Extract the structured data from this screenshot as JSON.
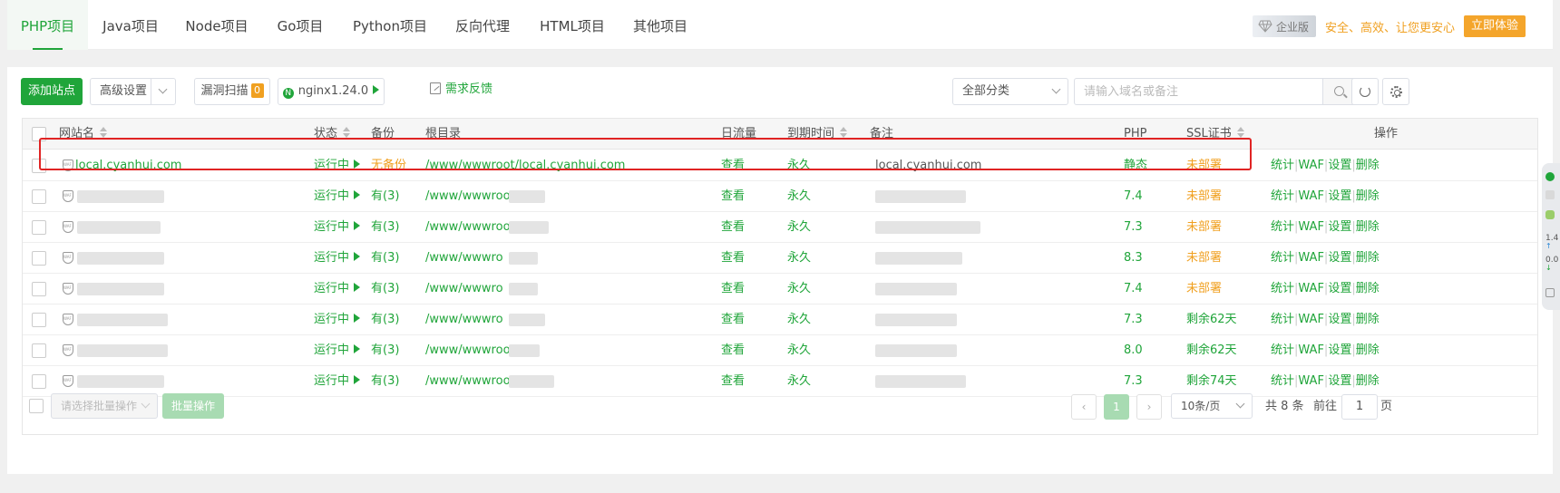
{
  "tabs": [
    "PHP项目",
    "Java项目",
    "Node项目",
    "Go项目",
    "Python项目",
    "反向代理",
    "HTML项目",
    "其他项目"
  ],
  "enterprise": {
    "badge": "企业版",
    "slogan": "安全、高效、让您更安心",
    "cta": "立即体验"
  },
  "toolbar": {
    "add_site": "添加站点",
    "advanced": "高级设置",
    "scan": "漏洞扫描",
    "scan_count": "0",
    "nginx": "nginx1.24.0",
    "feedback": "需求反馈",
    "category": "全部分类",
    "search_placeholder": "请输入域名或备注"
  },
  "table": {
    "headers": {
      "site": "网站名",
      "status": "状态",
      "backup": "备份",
      "root": "根目录",
      "traffic": "日流量",
      "expire": "到期时间",
      "remark": "备注",
      "php": "PHP",
      "ssl": "SSL证书",
      "ops": "操作"
    },
    "rows": [
      {
        "site": "local.cyanhui.com",
        "status": "运行中",
        "backup": "无备份",
        "root": "/www/wwwroot/local.cyanhui.com",
        "traffic": "查看",
        "expire": "永久",
        "remark": "local.cyanhui.com",
        "php": "静态",
        "ssl": "未部署"
      },
      {
        "site": "",
        "status": "运行中",
        "backup": "有(3)",
        "root": "/www/wwwroot",
        "traffic": "查看",
        "expire": "永久",
        "remark": "",
        "php": "7.4",
        "ssl": "未部署"
      },
      {
        "site": "",
        "status": "运行中",
        "backup": "有(3)",
        "root": "/www/wwwroo",
        "traffic": "查看",
        "expire": "永久",
        "remark": "",
        "php": "7.3",
        "ssl": "未部署"
      },
      {
        "site": "",
        "status": "运行中",
        "backup": "有(3)",
        "root": "/www/wwwro",
        "traffic": "查看",
        "expire": "永久",
        "remark": "",
        "php": "8.3",
        "ssl": "未部署"
      },
      {
        "site": "",
        "status": "运行中",
        "backup": "有(3)",
        "root": "/www/wwwro",
        "traffic": "查看",
        "expire": "永久",
        "remark": "",
        "php": "7.4",
        "ssl": "未部署"
      },
      {
        "site": "",
        "status": "运行中",
        "backup": "有(3)",
        "root": "/www/wwwro",
        "traffic": "查看",
        "expire": "永久",
        "remark": "",
        "php": "7.3",
        "ssl": "剩余62天"
      },
      {
        "site": "",
        "status": "运行中",
        "backup": "有(3)",
        "root": "/www/wwwroo",
        "traffic": "查看",
        "expire": "永久",
        "remark": "",
        "php": "8.0",
        "ssl": "剩余62天"
      },
      {
        "site": "",
        "status": "运行中",
        "backup": "有(3)",
        "root": "/www/wwwroot/",
        "traffic": "查看",
        "expire": "永久",
        "remark": "",
        "php": "7.3",
        "ssl": "剩余74天"
      }
    ],
    "ops": [
      "统计",
      "WAF",
      "设置",
      "删除"
    ]
  },
  "footer": {
    "batch_select": "请选择批量操作",
    "batch_btn": "批量操作",
    "prev": "‹",
    "next": "›",
    "page": "1",
    "per_page": "10条/页",
    "total": "共 8 条",
    "goto": "前往",
    "goto_value": "1",
    "page_suffix": "页"
  },
  "widget": {
    "up": "1.4",
    "down": "0.0",
    "unit": "K/s"
  },
  "colors": {
    "accent": "#20a53a",
    "warning": "#f0a020",
    "highlight": "#e02424"
  }
}
